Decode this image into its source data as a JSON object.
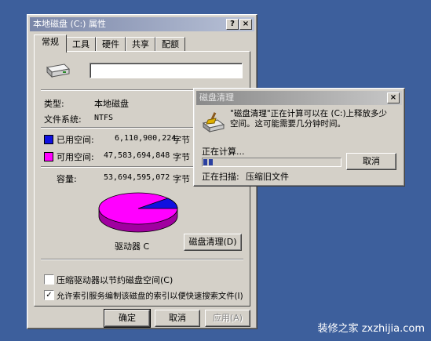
{
  "properties": {
    "title": "本地磁盘 (C:) 属性",
    "title_help": "?",
    "title_close": "×",
    "tabs": [
      "常规",
      "工具",
      "硬件",
      "共享",
      "配额"
    ],
    "drive_name_value": "",
    "type_label": "类型:",
    "type_value": "本地磁盘",
    "fs_label": "文件系统:",
    "fs_value": "NTFS",
    "used_label": "已用空间:",
    "used_value": "6,110,900,224",
    "used_unit": "字节",
    "free_label": "可用空间:",
    "free_value": "47,583,694,848",
    "free_unit": "字节",
    "capacity_label": "容量:",
    "capacity_value": "53,694,595,072",
    "capacity_unit": "字节",
    "drive_label": "驱动器 C",
    "cleanup_button": "磁盘清理(D)",
    "compress_label": "压缩驱动器以节约磁盘空间(C)",
    "compress_checked": false,
    "index_label": "允许索引服务编制该磁盘的索引以便快速搜索文件(I)",
    "index_checked": true,
    "ok": "确定",
    "cancel": "取消",
    "apply": "应用(A)",
    "colors": {
      "used": "#1010e0",
      "free": "#ff00ff"
    },
    "pie": {
      "used_fraction": 0.114
    }
  },
  "cleanup": {
    "title": "磁盘清理",
    "close": "×",
    "message": "\"磁盘清理\"正在计算可以在 (C:)上释放多少空间。这可能需要几分钟时间。",
    "calculating": "正在计算...",
    "cancel": "取消",
    "scanning_label": "正在扫描:",
    "scanning_value": "压缩旧文件",
    "progress": 0.07
  },
  "watermark": "装修之家 zxzhijia.com"
}
